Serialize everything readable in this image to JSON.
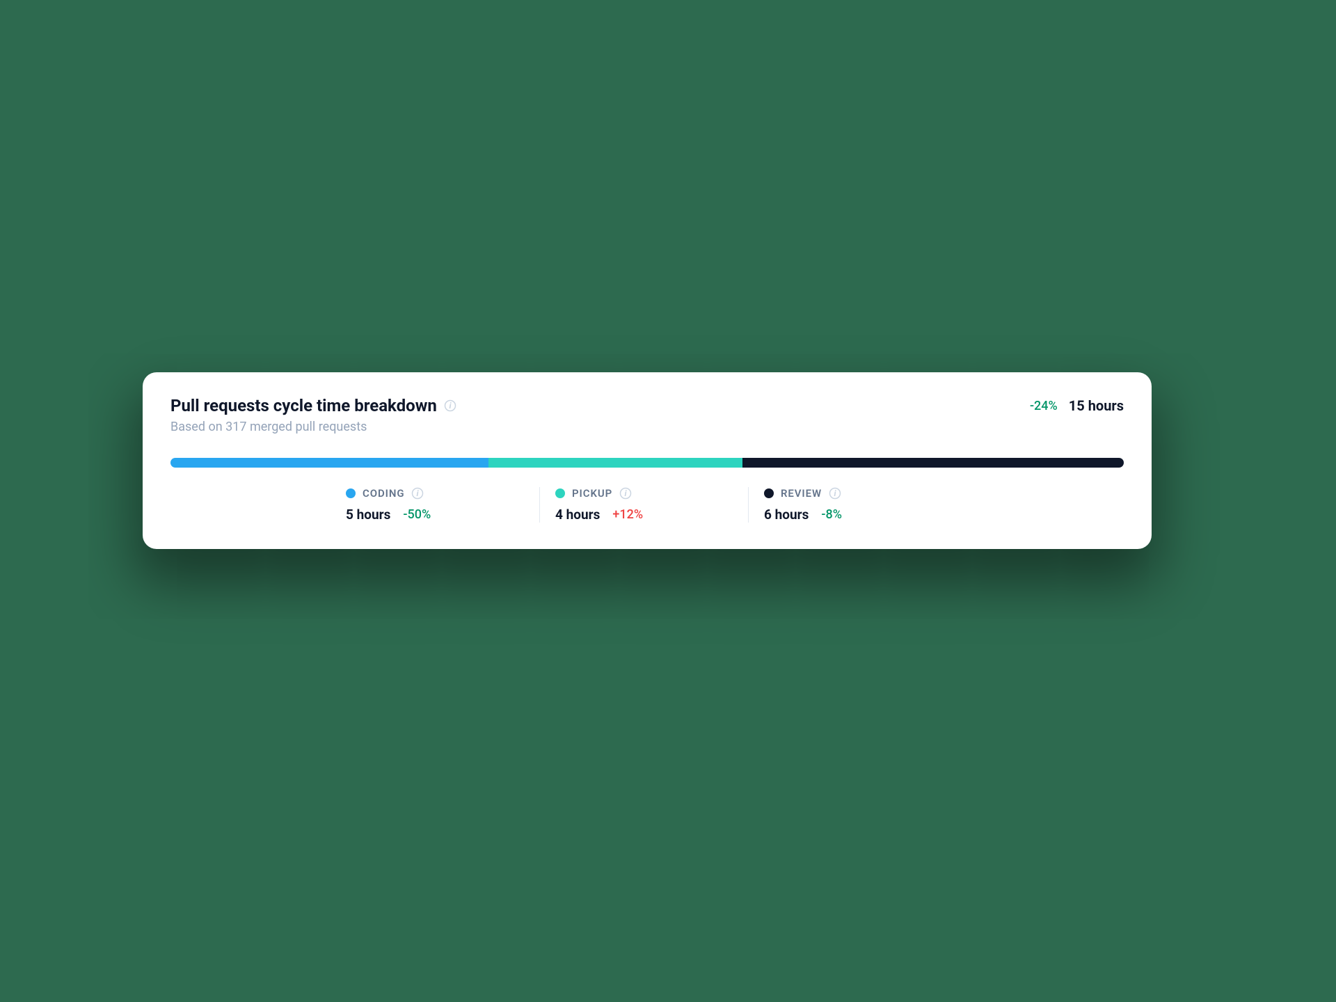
{
  "card": {
    "title": "Pull requests cycle time breakdown",
    "subtitle": "Based on 317 merged pull requests",
    "total_delta": "-24%",
    "total_delta_sign": "neg",
    "total_value": "15 hours"
  },
  "segments": [
    {
      "id": "coding",
      "label": "CODING",
      "value": "5 hours",
      "delta": "-50%",
      "delta_sign": "neg",
      "color": "#29a6f0",
      "hours": 5
    },
    {
      "id": "pickup",
      "label": "PICKUP",
      "value": "4 hours",
      "delta": "+12%",
      "delta_sign": "pos",
      "color": "#2dd4bf",
      "hours": 4
    },
    {
      "id": "review",
      "label": "REVIEW",
      "value": "6 hours",
      "delta": "-8%",
      "delta_sign": "neg",
      "color": "#0f172a",
      "hours": 6
    }
  ],
  "chart_data": {
    "type": "bar",
    "title": "Pull requests cycle time breakdown",
    "categories": [
      "Coding",
      "Pickup",
      "Review"
    ],
    "values": [
      5,
      4,
      6
    ],
    "unit": "hours",
    "total": 15,
    "series": [
      {
        "name": "Coding",
        "value": 5,
        "delta_pct": -50,
        "color": "#29a6f0"
      },
      {
        "name": "Pickup",
        "value": 4,
        "delta_pct": 12,
        "color": "#2dd4bf"
      },
      {
        "name": "Review",
        "value": 6,
        "delta_pct": -8,
        "color": "#0f172a"
      }
    ],
    "overall_delta_pct": -24,
    "xlabel": "",
    "ylabel": "hours"
  }
}
